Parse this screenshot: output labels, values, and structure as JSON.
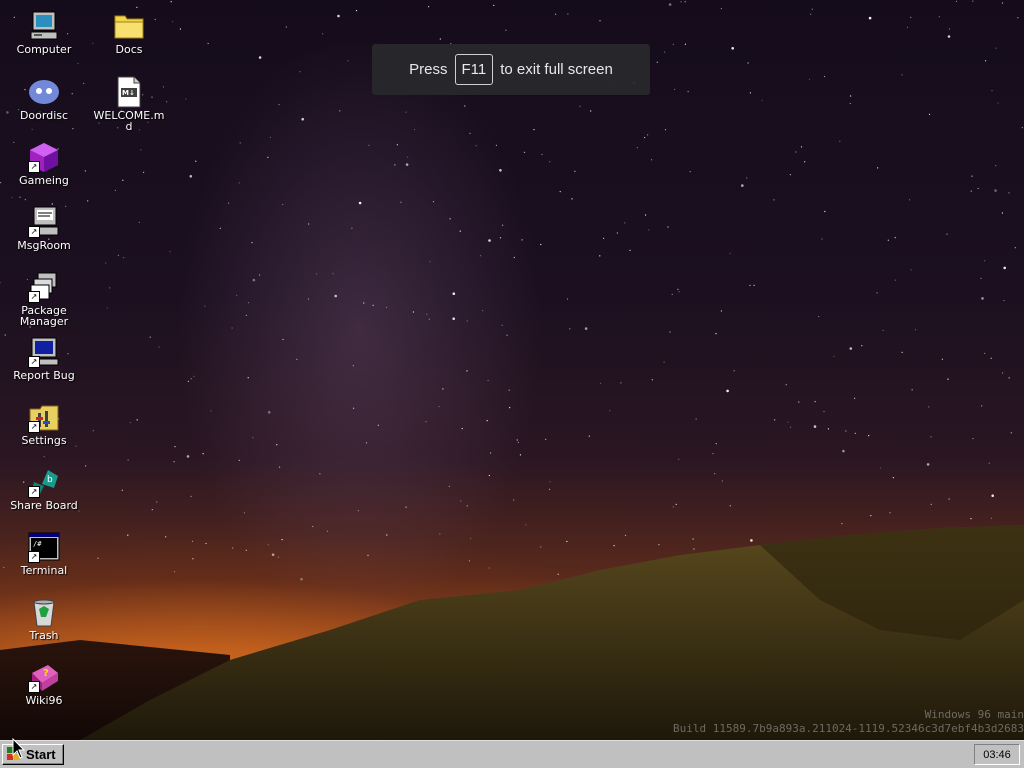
{
  "desktop": {
    "icons": [
      {
        "label": "Computer",
        "icon": "computer-icon",
        "shortcut": false
      },
      {
        "label": "Doordisc",
        "icon": "doordisc-icon",
        "shortcut": false
      },
      {
        "label": "Gameing",
        "icon": "gameing-icon",
        "shortcut": true
      },
      {
        "label": "MsgRoom",
        "icon": "msgroom-icon",
        "shortcut": true
      },
      {
        "label": "Package Manager",
        "icon": "package-manager-icon",
        "shortcut": true
      },
      {
        "label": "Report Bug",
        "icon": "report-bug-icon",
        "shortcut": true
      },
      {
        "label": "Settings",
        "icon": "settings-icon",
        "shortcut": true
      },
      {
        "label": "Share Board",
        "icon": "share-board-icon",
        "shortcut": true
      },
      {
        "label": "Terminal",
        "icon": "terminal-icon",
        "shortcut": true
      },
      {
        "label": "Trash",
        "icon": "trash-icon",
        "shortcut": false
      },
      {
        "label": "Wiki96",
        "icon": "wiki96-icon",
        "shortcut": true
      },
      {
        "label": "Docs",
        "icon": "folder-icon",
        "shortcut": false
      },
      {
        "label": "WELCOME.md",
        "icon": "markdown-file-icon",
        "shortcut": false
      }
    ]
  },
  "fullscreen_notice": {
    "prefix": "Press",
    "key": "F11",
    "suffix": "to exit full screen"
  },
  "build_watermark": {
    "line1": "Windows 96 main",
    "line2": "Build 11589.7b9a893a.211024-1119.52346c3d7ebf4b3d2683"
  },
  "taskbar": {
    "start_label": "Start",
    "clock": "03:46"
  },
  "colors": {
    "taskbar": "#c0c0c0",
    "sky": "#1c1020",
    "horizon_glow": "#e87620"
  }
}
